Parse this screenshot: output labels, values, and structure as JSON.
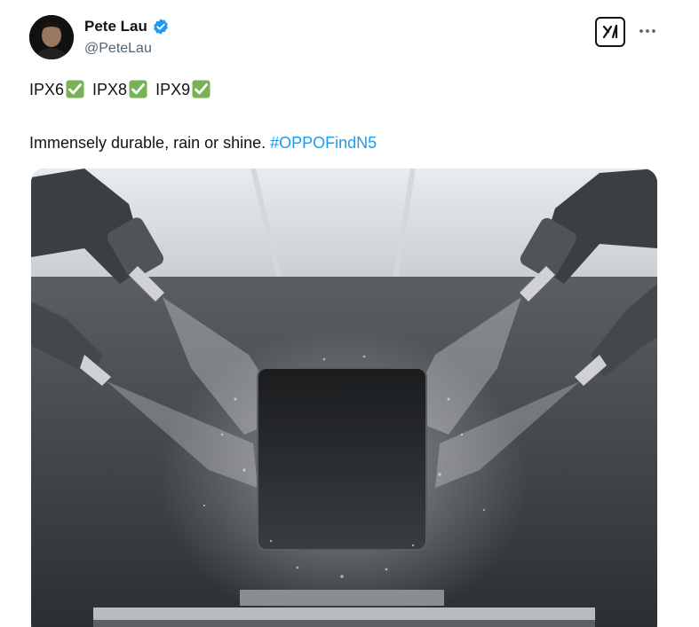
{
  "author": {
    "name": "Pete Lau",
    "handle": "@PeteLau",
    "verified": true,
    "verified_icon": "verified-badge-icon"
  },
  "actions": {
    "grok_icon": "grok-icon",
    "more_icon": "more-dots-icon",
    "more_label": "···"
  },
  "tweet": {
    "ratings": [
      "IPX6",
      "IPX8",
      "IPX9"
    ],
    "check_icon": "white-check-mark-emoji",
    "text": "Immensely durable, rain or shine. ",
    "hashtag": "#OPPOFindN5"
  },
  "media": {
    "icon": "photo"
  },
  "colors": {
    "text": "#0f1419",
    "secondary": "#536471",
    "link": "#1d9bf0",
    "verified": "#1d9bf0",
    "check_emoji": "#77b255"
  }
}
